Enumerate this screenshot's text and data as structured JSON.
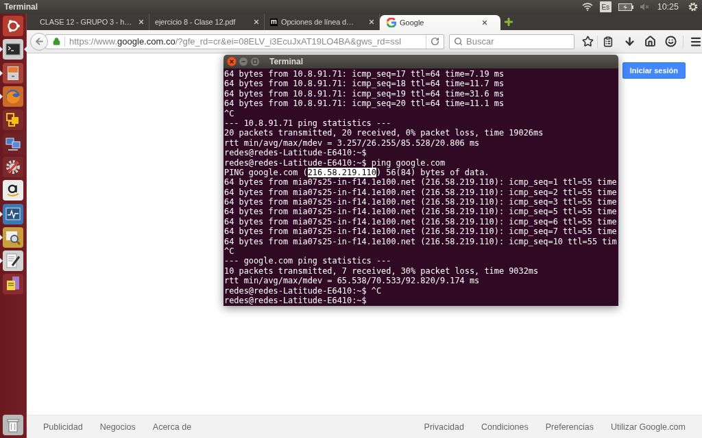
{
  "top_panel": {
    "title": "Terminal",
    "keyboard_layout": "Es",
    "time": "10:25"
  },
  "launcher": [
    {
      "kind": "home",
      "running": false,
      "focused": false
    },
    {
      "kind": "terminal",
      "running": true,
      "focused": true
    },
    {
      "kind": "files",
      "running": true,
      "focused": false
    },
    {
      "kind": "browser",
      "running": true,
      "focused": false
    },
    {
      "kind": "virtual",
      "running": false,
      "focused": false
    },
    {
      "kind": "network",
      "running": false,
      "focused": false
    },
    {
      "kind": "settings",
      "running": false,
      "focused": false
    },
    {
      "kind": "store",
      "running": false,
      "focused": false
    },
    {
      "kind": "monitor",
      "running": true,
      "focused": false
    },
    {
      "kind": "photos",
      "running": true,
      "focused": false
    },
    {
      "kind": "editor",
      "running": true,
      "focused": false
    },
    {
      "kind": "notes",
      "running": false,
      "focused": false
    }
  ],
  "browser": {
    "tabs": [
      {
        "label": "CLASE 12 - GRUPO 3 - h…",
        "kind": "plain",
        "selected": false
      },
      {
        "label": "ejercicio 8 - Clase 12.pdf",
        "kind": "plain",
        "selected": false
      },
      {
        "label": "Opciones de línea d…",
        "kind": "letter",
        "favicon": "m",
        "selected": false
      },
      {
        "label": "Google",
        "kind": "google",
        "selected": true
      }
    ],
    "address": {
      "prefix": "https://www.",
      "domain": "google.com.co",
      "suffix": "/?gfe_rd=cr&ei=08ELV_i3EcuJxAT19LO4BA&gws_rd=ssl"
    },
    "search": {
      "placeholder": "Buscar"
    }
  },
  "page": {
    "sign_in_button": "Iniciar sesión",
    "footer_left": [
      "Publicidad",
      "Negocios",
      "Acerca de"
    ],
    "footer_right": [
      "Privacidad",
      "Condiciones",
      "Preferencias",
      "Utilizar Google.com"
    ]
  },
  "terminal": {
    "title": "Terminal",
    "lines": [
      {
        "text": "64 bytes from 10.8.91.71: icmp_seq=17 ttl=64 time=7.19 ms"
      },
      {
        "text": "64 bytes from 10.8.91.71: icmp_seq=18 ttl=64 time=11.7 ms"
      },
      {
        "text": "64 bytes from 10.8.91.71: icmp_seq=19 ttl=64 time=31.6 ms"
      },
      {
        "text": "64 bytes from 10.8.91.71: icmp_seq=20 ttl=64 time=11.1 ms"
      },
      {
        "text": "^C"
      },
      {
        "text": "--- 10.8.91.71 ping statistics ---"
      },
      {
        "text": "20 packets transmitted, 20 received, 0% packet loss, time 19026ms"
      },
      {
        "text": "rtt min/avg/max/mdev = 3.257/26.255/85.528/20.806 ms"
      },
      {
        "text": "redes@redes-Latitude-E6410:~$"
      },
      {
        "text": "redes@redes-Latitude-E6410:~$ ping google.com"
      },
      {
        "segments": [
          {
            "text": "PING google.com (",
            "selected": false
          },
          {
            "text": "216.58.219.110",
            "selected": true
          },
          {
            "text": ") 56(84) bytes of data.",
            "selected": false
          }
        ]
      },
      {
        "text": "64 bytes from mia07s25-in-f14.1e100.net (216.58.219.110): icmp_seq=1 ttl=55 time"
      },
      {
        "text": "64 bytes from mia07s25-in-f14.1e100.net (216.58.219.110): icmp_seq=2 ttl=55 time"
      },
      {
        "text": "64 bytes from mia07s25-in-f14.1e100.net (216.58.219.110): icmp_seq=3 ttl=55 time"
      },
      {
        "text": "64 bytes from mia07s25-in-f14.1e100.net (216.58.219.110): icmp_seq=5 ttl=55 time"
      },
      {
        "text": "64 bytes from mia07s25-in-f14.1e100.net (216.58.219.110): icmp_seq=6 ttl=55 time"
      },
      {
        "text": "64 bytes from mia07s25-in-f14.1e100.net (216.58.219.110): icmp_seq=7 ttl=55 time"
      },
      {
        "text": "64 bytes from mia07s25-in-f14.1e100.net (216.58.219.110): icmp_seq=10 ttl=55 tim"
      },
      {
        "text": "^C"
      },
      {
        "text": "--- google.com ping statistics ---"
      },
      {
        "text": "10 packets transmitted, 7 received, 30% packet loss, time 9032ms"
      },
      {
        "text": "rtt min/avg/max/mdev = 65.538/70.533/92.820/9.174 ms"
      },
      {
        "text": "redes@redes-Latitude-E6410:~$ ^C"
      },
      {
        "text": "redes@redes-Latitude-E6410:~$"
      }
    ]
  }
}
